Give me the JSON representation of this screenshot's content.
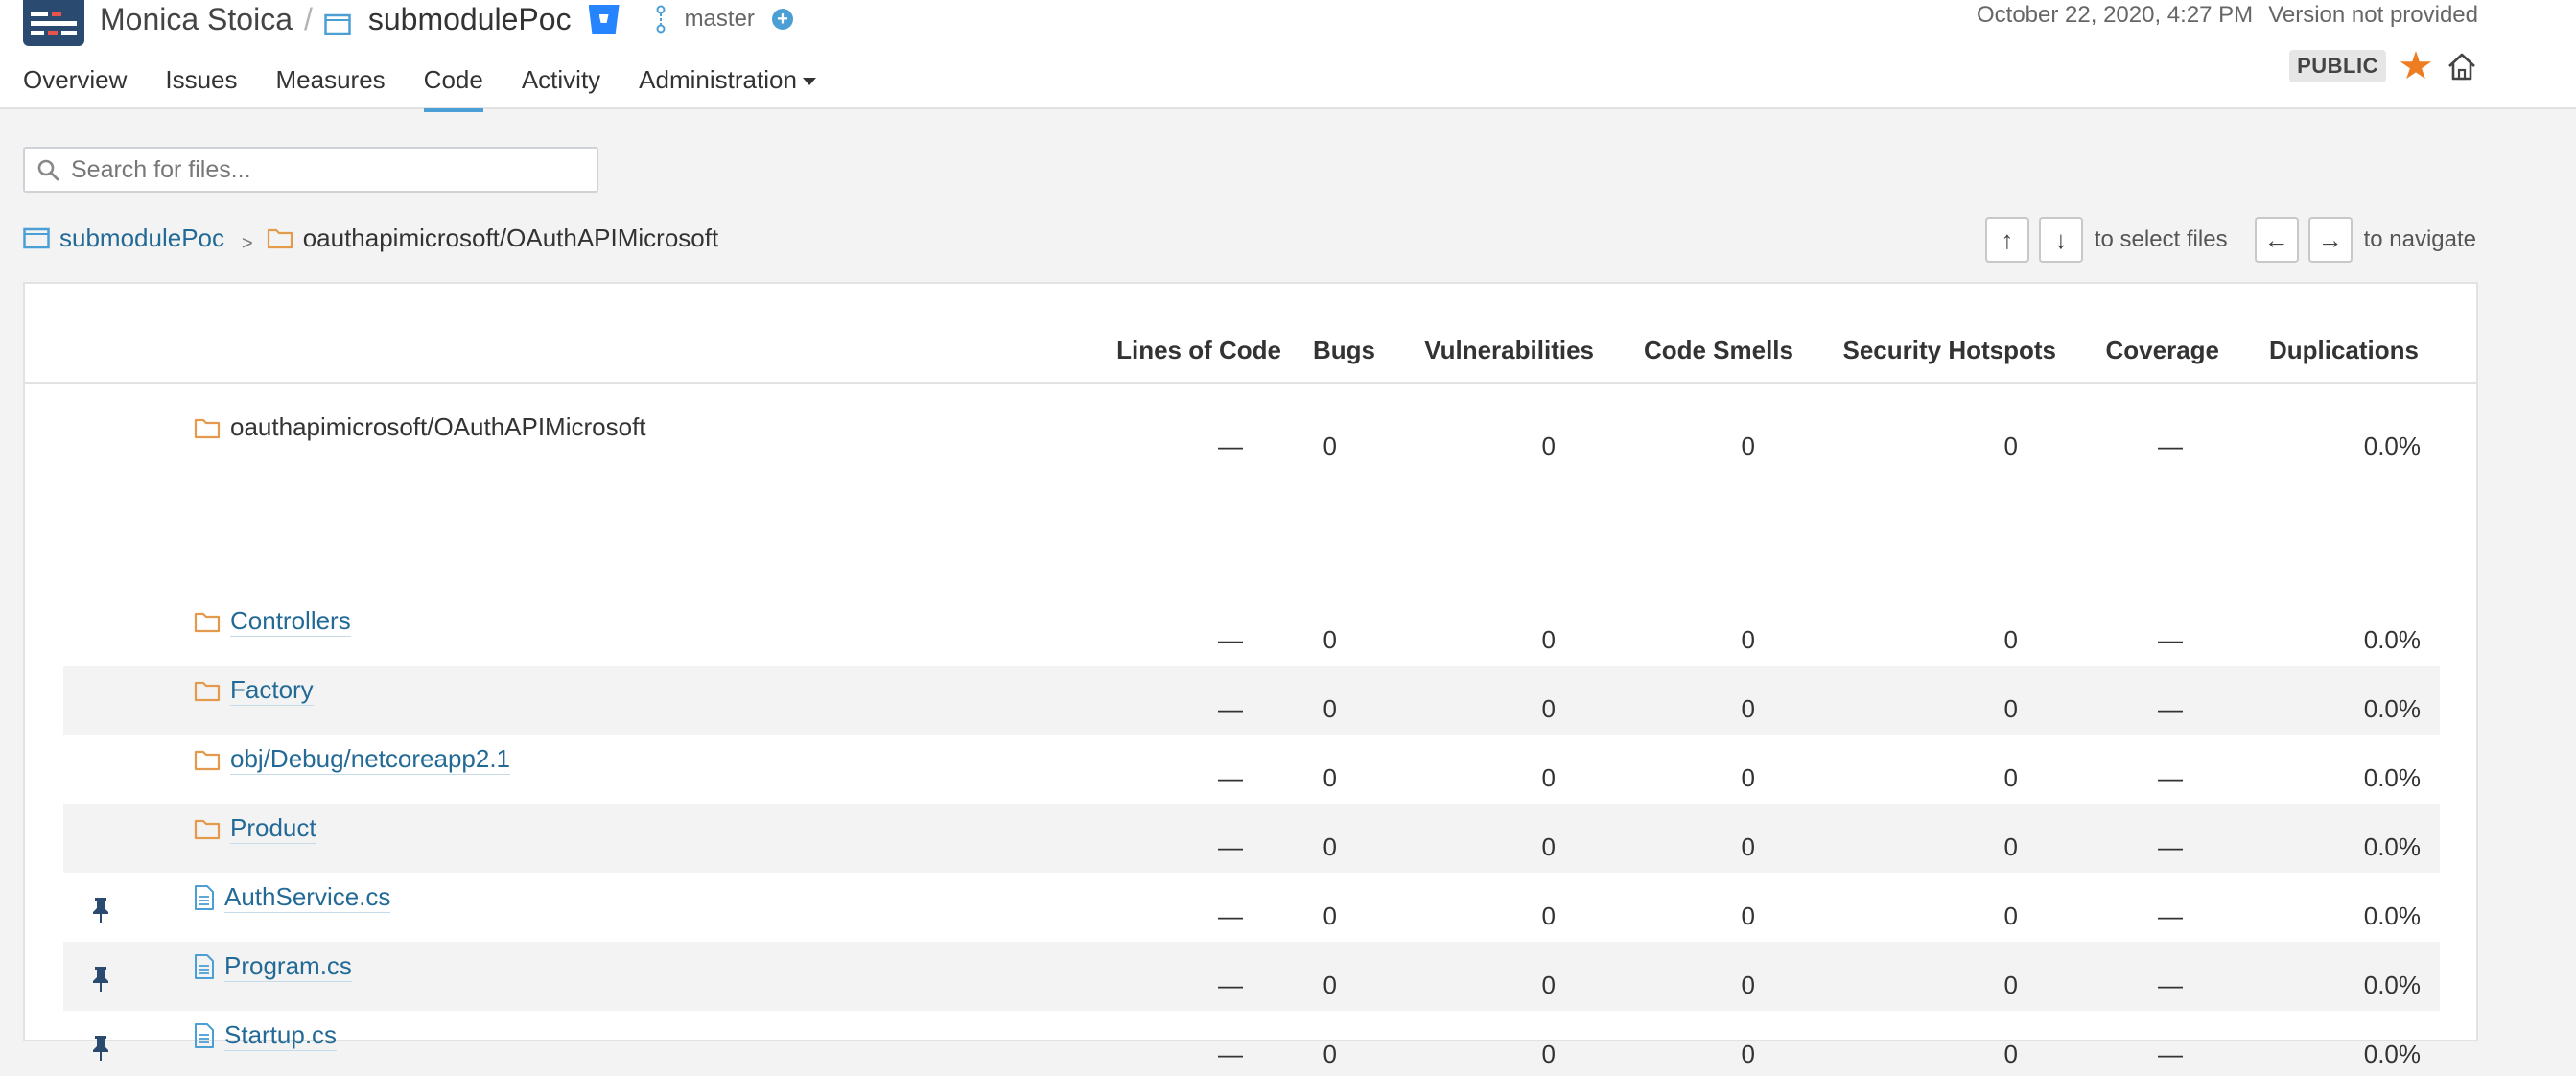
{
  "header": {
    "organization": "Monica Stoica",
    "separator": "/",
    "project": "submodulePoc",
    "branch": "master",
    "date": "October 22, 2020, 4:27 PM",
    "version": "Version not provided",
    "visibility_badge": "PUBLIC"
  },
  "nav": {
    "items": [
      {
        "label": "Overview",
        "active": false
      },
      {
        "label": "Issues",
        "active": false
      },
      {
        "label": "Measures",
        "active": false
      },
      {
        "label": "Code",
        "active": true
      },
      {
        "label": "Activity",
        "active": false
      },
      {
        "label": "Administration",
        "active": false
      }
    ]
  },
  "search": {
    "placeholder": "Search for files..."
  },
  "path": {
    "root": "submodulePoc",
    "separator": ">",
    "current": "oauthapimicrosoft/OAuthAPIMicrosoft"
  },
  "keyboard_hints": {
    "up": "↑",
    "down": "↓",
    "select_label": "to select files",
    "left": "←",
    "right": "→",
    "navigate_label": "to navigate"
  },
  "table": {
    "columns": [
      "Lines of Code",
      "Bugs",
      "Vulnerabilities",
      "Code Smells",
      "Security Hotspots",
      "Coverage",
      "Duplications"
    ],
    "base_row": {
      "name": "oauthapimicrosoft/OAuthAPIMicrosoft",
      "type": "folder",
      "values": [
        "—",
        "0",
        "0",
        "0",
        "0",
        "—",
        "0.0%"
      ]
    },
    "rows": [
      {
        "name": "Controllers",
        "type": "folder",
        "values": [
          "—",
          "0",
          "0",
          "0",
          "0",
          "—",
          "0.0%"
        ]
      },
      {
        "name": "Factory",
        "type": "folder",
        "values": [
          "—",
          "0",
          "0",
          "0",
          "0",
          "—",
          "0.0%"
        ]
      },
      {
        "name": "obj/Debug/netcoreapp2.1",
        "type": "folder",
        "values": [
          "—",
          "0",
          "0",
          "0",
          "0",
          "—",
          "0.0%"
        ]
      },
      {
        "name": "Product",
        "type": "folder",
        "values": [
          "—",
          "0",
          "0",
          "0",
          "0",
          "—",
          "0.0%"
        ]
      },
      {
        "name": "AuthService.cs",
        "type": "file",
        "values": [
          "—",
          "0",
          "0",
          "0",
          "0",
          "—",
          "0.0%"
        ]
      },
      {
        "name": "Program.cs",
        "type": "file",
        "values": [
          "—",
          "0",
          "0",
          "0",
          "0",
          "—",
          "0.0%"
        ]
      },
      {
        "name": "Startup.cs",
        "type": "file",
        "values": [
          "—",
          "0",
          "0",
          "0",
          "0",
          "—",
          "0.0%"
        ]
      }
    ]
  },
  "colors": {
    "accent": "#4b9fd5",
    "link": "#236a97",
    "folder": "#e39a4d",
    "star": "#ed7d20",
    "pin": "#2b4a6f"
  }
}
